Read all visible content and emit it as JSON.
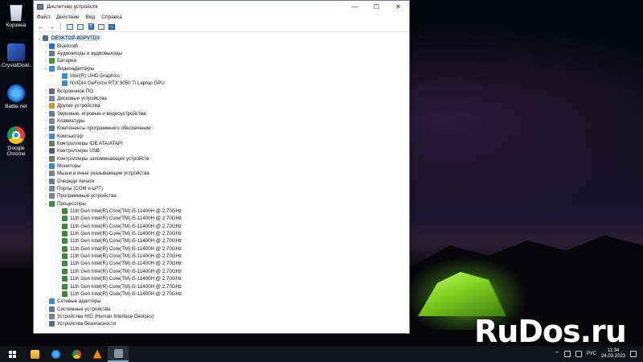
{
  "desktop": {
    "icons": [
      {
        "label": "Корзина"
      },
      {
        "label": "CrystalDiskI..."
      },
      {
        "label": "Battle.net"
      },
      {
        "label": "Google Chrome"
      }
    ],
    "watermark": "RuDos.ru"
  },
  "window": {
    "title": "Диспетчер устройств",
    "controls": {
      "minimize": "—",
      "maximize": "☐",
      "close": "✕"
    },
    "menu": [
      "Файл",
      "Действие",
      "Вид",
      "Справка"
    ],
    "toolbar": [
      "back-arrow-icon",
      "forward-arrow-icon",
      "properties-icon",
      "details-icon",
      "help-icon",
      "show-hidden-icon",
      "monitor-icon"
    ],
    "tree": [
      {
        "level": 0,
        "expanded": true,
        "label": "DESKTOP-8GPVTD3",
        "icon": "computer-icon",
        "color": "#4a6e8d",
        "selected": true
      },
      {
        "level": 1,
        "expanded": false,
        "label": "Bluetooth",
        "icon": "bluetooth-icon",
        "color": "#1e6fd8"
      },
      {
        "level": 1,
        "expanded": false,
        "label": "Аудиовходы и аудиовыходы",
        "icon": "speaker-icon",
        "color": "#6a7b8c"
      },
      {
        "level": 1,
        "expanded": false,
        "label": "Батареи",
        "icon": "battery-icon",
        "color": "#3a9a3a"
      },
      {
        "level": 1,
        "expanded": true,
        "label": "Видеоадаптеры",
        "icon": "display-adapter-icon",
        "color": "#3a8ad0"
      },
      {
        "level": 2,
        "label": "Intel(R) UHD Graphics",
        "icon": "display-adapter-icon",
        "color": "#3a8ad0"
      },
      {
        "level": 2,
        "label": "NVIDIA GeForce RTX 3050 Ti Laptop GPU",
        "icon": "display-adapter-icon",
        "color": "#3a8ad0"
      },
      {
        "level": 1,
        "expanded": false,
        "label": "Встроенное ПО",
        "icon": "firmware-icon",
        "color": "#5a6a7a"
      },
      {
        "level": 1,
        "expanded": false,
        "label": "Дисковые устройства",
        "icon": "disk-icon",
        "color": "#7a8592"
      },
      {
        "level": 1,
        "expanded": false,
        "label": "Другие устройства",
        "icon": "other-devices-icon",
        "color": "#c79a2a"
      },
      {
        "level": 1,
        "expanded": false,
        "label": "Звуковые, игровые и видеоустройства",
        "icon": "sound-icon",
        "color": "#6a7b8c"
      },
      {
        "level": 1,
        "expanded": false,
        "label": "Клавиатуры",
        "icon": "keyboard-icon",
        "color": "#7a8592"
      },
      {
        "level": 1,
        "expanded": false,
        "label": "Компоненты программного обеспечения",
        "icon": "software-component-icon",
        "color": "#5a7aa0"
      },
      {
        "level": 1,
        "expanded": false,
        "label": "Компьютер",
        "icon": "computer-icon",
        "color": "#3a8ad0"
      },
      {
        "level": 1,
        "expanded": false,
        "label": "Контроллеры IDE ATA/ATAPI",
        "icon": "ide-controller-icon",
        "color": "#6a7a6a"
      },
      {
        "level": 1,
        "expanded": false,
        "label": "Контроллеры USB",
        "icon": "usb-icon",
        "color": "#555e68"
      },
      {
        "level": 1,
        "expanded": false,
        "label": "Контроллеры запоминающих устройств",
        "icon": "storage-controller-icon",
        "color": "#6a7a6a"
      },
      {
        "level": 1,
        "expanded": false,
        "label": "Мониторы",
        "icon": "monitor-icon",
        "color": "#3a8ad0"
      },
      {
        "level": 1,
        "expanded": false,
        "label": "Мыши и иные указывающие устройства",
        "icon": "mouse-icon",
        "color": "#7a8592"
      },
      {
        "level": 1,
        "expanded": false,
        "label": "Очереди печати",
        "icon": "printer-icon",
        "color": "#6a7b8c"
      },
      {
        "level": 1,
        "expanded": false,
        "label": "Порты (COM и LPT)",
        "icon": "port-icon",
        "color": "#7a8592"
      },
      {
        "level": 1,
        "expanded": false,
        "label": "Программные устройства",
        "icon": "software-device-icon",
        "color": "#7a8592"
      },
      {
        "level": 1,
        "expanded": true,
        "label": "Процессоры",
        "icon": "processor-icon",
        "color": "#3d8a3d"
      },
      {
        "level": 2,
        "label": "11th Gen Intel(R) Core(TM) i5-11400H @ 2.70GHz",
        "icon": "processor-icon",
        "color": "#3d8a3d"
      },
      {
        "level": 2,
        "label": "11th Gen Intel(R) Core(TM) i5-11400H @ 2.70GHz",
        "icon": "processor-icon",
        "color": "#3d8a3d"
      },
      {
        "level": 2,
        "label": "11th Gen Intel(R) Core(TM) i5-11400H @ 2.70GHz",
        "icon": "processor-icon",
        "color": "#3d8a3d"
      },
      {
        "level": 2,
        "label": "11th Gen Intel(R) Core(TM) i5-11400H @ 2.70GHz",
        "icon": "processor-icon",
        "color": "#3d8a3d"
      },
      {
        "level": 2,
        "label": "11th Gen Intel(R) Core(TM) i5-11400H @ 2.70GHz",
        "icon": "processor-icon",
        "color": "#3d8a3d"
      },
      {
        "level": 2,
        "label": "11th Gen Intel(R) Core(TM) i5-11400H @ 2.70GHz",
        "icon": "processor-icon",
        "color": "#3d8a3d"
      },
      {
        "level": 2,
        "label": "11th Gen Intel(R) Core(TM) i5-11400H @ 2.70GHz",
        "icon": "processor-icon",
        "color": "#3d8a3d"
      },
      {
        "level": 2,
        "label": "11th Gen Intel(R) Core(TM) i5-11400H @ 2.70GHz",
        "icon": "processor-icon",
        "color": "#3d8a3d"
      },
      {
        "level": 2,
        "label": "11th Gen Intel(R) Core(TM) i5-11400H @ 2.70GHz",
        "icon": "processor-icon",
        "color": "#3d8a3d"
      },
      {
        "level": 2,
        "label": "11th Gen Intel(R) Core(TM) i5-11400H @ 2.70GHz",
        "icon": "processor-icon",
        "color": "#3d8a3d"
      },
      {
        "level": 2,
        "label": "11th Gen Intel(R) Core(TM) i5-11400H @ 2.70GHz",
        "icon": "processor-icon",
        "color": "#3d8a3d"
      },
      {
        "level": 2,
        "label": "11th Gen Intel(R) Core(TM) i5-11400H @ 2.70GHz",
        "icon": "processor-icon",
        "color": "#3d8a3d"
      },
      {
        "level": 1,
        "expanded": false,
        "label": "Сетевые адаптеры",
        "icon": "network-adapter-icon",
        "color": "#3a8ad0"
      },
      {
        "level": 1,
        "expanded": false,
        "label": "Системные устройства",
        "icon": "system-devices-icon",
        "color": "#5a7aa0"
      },
      {
        "level": 1,
        "expanded": false,
        "label": "Устройства HID (Human Interface Devices)",
        "icon": "hid-icon",
        "color": "#7a8592"
      },
      {
        "level": 1,
        "expanded": false,
        "label": "Устройства безопасности",
        "icon": "security-device-icon",
        "color": "#5a6a7a"
      }
    ]
  },
  "taskbar": {
    "apps": [
      "file-explorer-icon",
      "battle-net-icon",
      "chrome-icon",
      "vlc-icon",
      "device-manager-icon"
    ],
    "tray": {
      "language": "РУС",
      "time": "11:34",
      "date": "24.03.2023"
    }
  }
}
